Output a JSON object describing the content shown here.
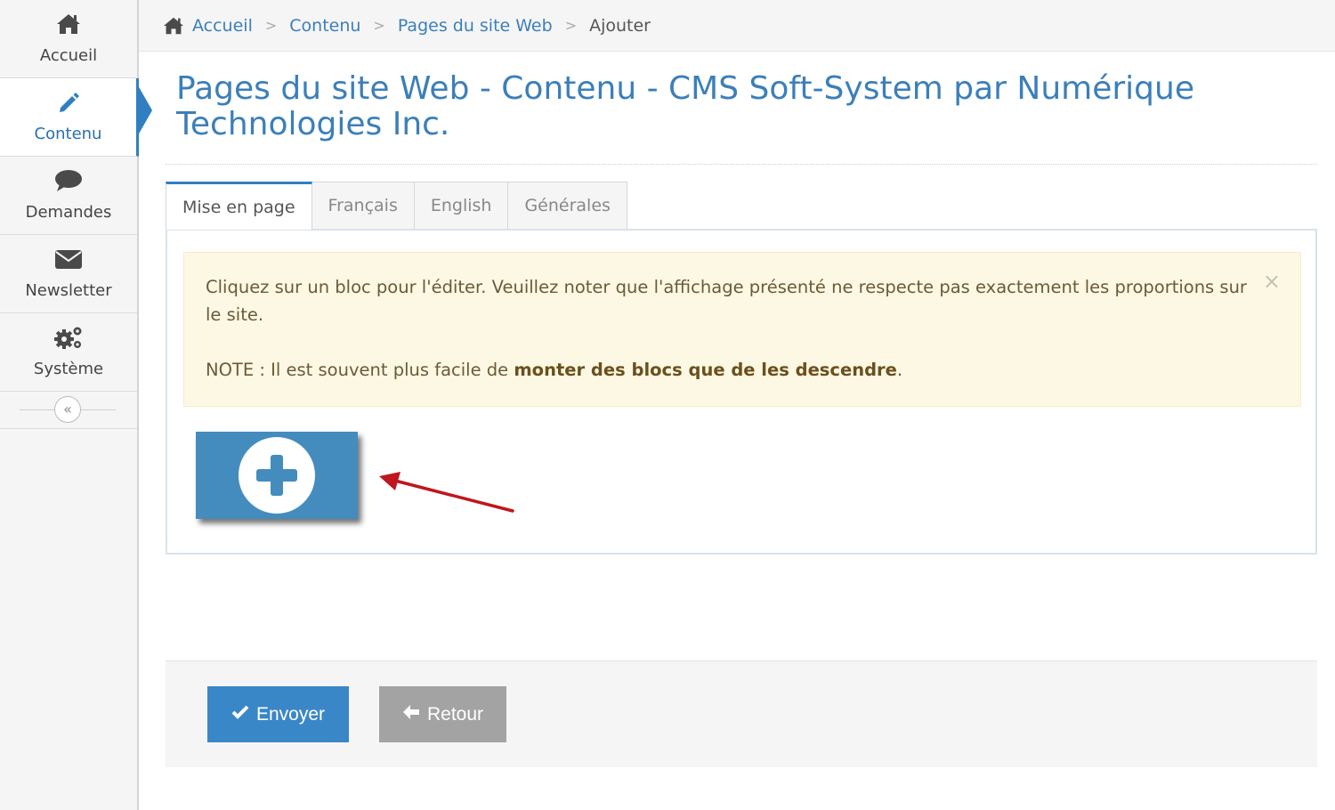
{
  "sidebar": {
    "items": [
      {
        "label": "Accueil",
        "icon": "home-icon"
      },
      {
        "label": "Contenu",
        "icon": "pencil-icon",
        "active": true
      },
      {
        "label": "Demandes",
        "icon": "comment-icon"
      },
      {
        "label": "Newsletter",
        "icon": "envelope-icon"
      },
      {
        "label": "Système",
        "icon": "gears-icon"
      }
    ],
    "collapse_glyph": "«"
  },
  "breadcrumb": {
    "items": [
      "Accueil",
      "Contenu",
      "Pages du site Web"
    ],
    "current": "Ajouter",
    "separator": ">"
  },
  "page": {
    "title": "Pages du site Web - Contenu - CMS Soft-System par Numérique Technologies Inc."
  },
  "tabs": [
    {
      "label": "Mise en page",
      "active": true
    },
    {
      "label": "Français"
    },
    {
      "label": "English"
    },
    {
      "label": "Générales"
    }
  ],
  "alert": {
    "text": "Cliquez sur un bloc pour l'éditer. Veuillez noter que l'affichage présenté ne respecte pas exactement les proportions sur le site.",
    "note_prefix": "NOTE : Il est souvent plus facile de ",
    "note_bold": "monter des blocs que de les descendre",
    "note_suffix": ".",
    "close_glyph": "×"
  },
  "footer": {
    "send_label": "Envoyer",
    "back_label": "Retour"
  },
  "colors": {
    "accent": "#3a87c8",
    "add_block": "#448cbd",
    "alert_bg": "#fcf8e3",
    "arrow": "#c0161d",
    "back_button": "#a3a3a3"
  }
}
